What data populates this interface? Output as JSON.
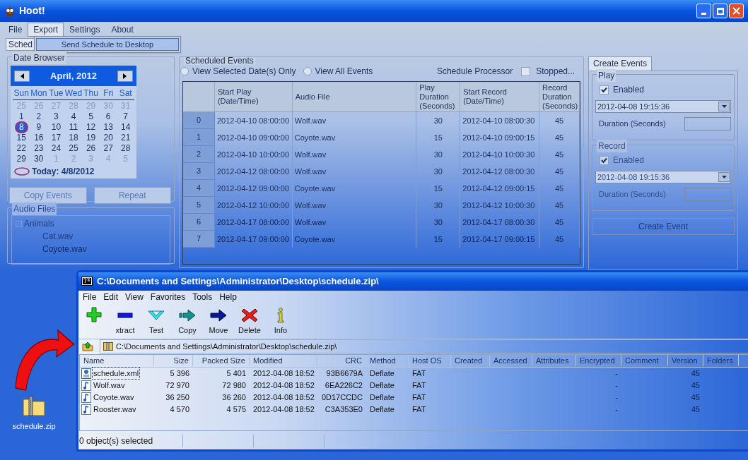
{
  "hoot_window": {
    "title": "Hoot!",
    "menu": [
      {
        "label": "File",
        "selected": false
      },
      {
        "label": "Export",
        "selected": true
      },
      {
        "label": "Settings",
        "selected": false
      },
      {
        "label": "About",
        "selected": false
      }
    ],
    "export_menu": [
      "Send Schedule to Desktop"
    ],
    "tab": "Sched",
    "date_browser": {
      "title": "Date Browser",
      "month": "April, 2012",
      "weekdays": [
        "Sun",
        "Mon",
        "Tue",
        "Wed",
        "Thu",
        "Fri",
        "Sat"
      ],
      "days": [
        {
          "label": "25",
          "muted": true,
          "selected": false
        },
        {
          "label": "26",
          "muted": true,
          "selected": false
        },
        {
          "label": "27",
          "muted": true,
          "selected": false
        },
        {
          "label": "28",
          "muted": true,
          "selected": false
        },
        {
          "label": "29",
          "muted": true,
          "selected": false
        },
        {
          "label": "30",
          "muted": true,
          "selected": false
        },
        {
          "label": "31",
          "muted": true,
          "selected": false
        },
        {
          "label": "1",
          "muted": false,
          "selected": false
        },
        {
          "label": "2",
          "muted": false,
          "selected": false
        },
        {
          "label": "3",
          "muted": false,
          "selected": false
        },
        {
          "label": "4",
          "muted": false,
          "selected": false
        },
        {
          "label": "5",
          "muted": false,
          "selected": false
        },
        {
          "label": "6",
          "muted": false,
          "selected": false
        },
        {
          "label": "7",
          "muted": false,
          "selected": false
        },
        {
          "label": "8",
          "muted": false,
          "selected": true
        },
        {
          "label": "9",
          "muted": false,
          "selected": false
        },
        {
          "label": "10",
          "muted": false,
          "selected": false
        },
        {
          "label": "11",
          "muted": false,
          "selected": false
        },
        {
          "label": "12",
          "muted": false,
          "selected": false
        },
        {
          "label": "13",
          "muted": false,
          "selected": false
        },
        {
          "label": "14",
          "muted": false,
          "selected": false
        },
        {
          "label": "15",
          "muted": false,
          "selected": false
        },
        {
          "label": "16",
          "muted": false,
          "selected": false
        },
        {
          "label": "17",
          "muted": false,
          "selected": false
        },
        {
          "label": "18",
          "muted": false,
          "selected": false
        },
        {
          "label": "19",
          "muted": false,
          "selected": false
        },
        {
          "label": "20",
          "muted": false,
          "selected": false
        },
        {
          "label": "21",
          "muted": false,
          "selected": false
        },
        {
          "label": "22",
          "muted": false,
          "selected": false
        },
        {
          "label": "23",
          "muted": false,
          "selected": false
        },
        {
          "label": "24",
          "muted": false,
          "selected": false
        },
        {
          "label": "25",
          "muted": false,
          "selected": false
        },
        {
          "label": "26",
          "muted": false,
          "selected": false
        },
        {
          "label": "27",
          "muted": false,
          "selected": false
        },
        {
          "label": "28",
          "muted": false,
          "selected": false
        },
        {
          "label": "29",
          "muted": false,
          "selected": false
        },
        {
          "label": "30",
          "muted": false,
          "selected": false
        },
        {
          "label": "1",
          "muted": true,
          "selected": false
        },
        {
          "label": "2",
          "muted": true,
          "selected": false
        },
        {
          "label": "3",
          "muted": true,
          "selected": false
        },
        {
          "label": "4",
          "muted": true,
          "selected": false
        },
        {
          "label": "5",
          "muted": true,
          "selected": false
        }
      ],
      "today": "Today: 4/8/2012"
    },
    "buttons": [
      "Copy Events",
      "Repeat"
    ],
    "audio_files": {
      "title": "Audio Files",
      "tree": [
        {
          "label": "Animals",
          "expanded": true,
          "children": [
            {
              "label": "Cat.wav"
            },
            {
              "label": "Coyote.wav"
            }
          ]
        }
      ]
    },
    "scheduled_events": {
      "title": "Scheduled Events",
      "radios": [
        {
          "label": "View Selected Date(s) Only",
          "selected": false
        },
        {
          "label": "View All Events",
          "selected": false
        }
      ],
      "processor_label": "Schedule Processor",
      "processor": {
        "label": "Stopped...",
        "checked": false
      },
      "columns": [
        "Start Play (Date/Time)",
        "Audio File",
        "Play Duration (Seconds)",
        "Start Record (Date/Time)",
        "Record Duration (Seconds)"
      ],
      "rows": [
        {
          "index": "0",
          "cells": [
            "2012-04-10 08:00:00",
            "Wolf.wav",
            "30",
            "2012-04-10 08:00:30",
            "45"
          ]
        },
        {
          "index": "1",
          "cells": [
            "2012-04-10 09:00:00",
            "Coyote.wav",
            "15",
            "2012-04-10 09:00:15",
            "45"
          ]
        },
        {
          "index": "2",
          "cells": [
            "2012-04-10 10:00:00",
            "Wolf.wav",
            "30",
            "2012-04-10 10:00:30",
            "45"
          ]
        },
        {
          "index": "3",
          "cells": [
            "2012-04-12 08:00:00",
            "Wolf.wav",
            "30",
            "2012-04-12 08:00:30",
            "45"
          ]
        },
        {
          "index": "4",
          "cells": [
            "2012-04-12 09:00:00",
            "Coyote.wav",
            "15",
            "2012-04-12 09:00:15",
            "45"
          ]
        },
        {
          "index": "5",
          "cells": [
            "2012-04-12 10:00:00",
            "Wolf.wav",
            "30",
            "2012-04-12 10:00:30",
            "45"
          ]
        },
        {
          "index": "6",
          "cells": [
            "2012-04-17 08:00:00",
            "Wolf.wav",
            "30",
            "2012-04-17 08:00:30",
            "45"
          ]
        },
        {
          "index": "7",
          "cells": [
            "2012-04-17 09:00:00",
            "Coyote.wav",
            "15",
            "2012-04-17 09:00:15",
            "45"
          ]
        }
      ]
    },
    "create_events": {
      "tab": "Create Events",
      "groups": [
        {
          "title": "Play",
          "enabled": {
            "label": "Enabled",
            "checked": true
          },
          "datetime": "2012-04-08 19:15:36",
          "duration_label": "Duration (Seconds)"
        },
        {
          "title": "Record",
          "enabled": {
            "label": "Enabled",
            "checked": true
          },
          "datetime": "2012-04-08 19:15:36",
          "duration_label": "Duration (Seconds)"
        }
      ],
      "button": "Create Event"
    }
  },
  "archive_window": {
    "title": "C:\\Documents and Settings\\Administrator\\Desktop\\schedule.zip\\",
    "menu": [
      "File",
      "Edit",
      "View",
      "Favorites",
      "Tools",
      "Help"
    ],
    "toolbar": [
      {
        "kind": "add"
      },
      {
        "kind": "extract",
        "label": "xtract"
      },
      {
        "kind": "test",
        "label": "Test"
      },
      {
        "kind": "copy",
        "label": "Copy"
      },
      {
        "kind": "move",
        "label": "Move"
      },
      {
        "kind": "delete",
        "label": "Delete"
      },
      {
        "kind": "info",
        "label": "Info"
      }
    ],
    "address": "C:\\Documents and Settings\\Administrator\\Desktop\\schedule.zip\\",
    "columns": [
      "Name",
      "Size",
      "Packed Size",
      "Modified",
      "CRC",
      "Method",
      "Host OS",
      "Created",
      "Accessed",
      "Attributes",
      "Encrypted",
      "Comment",
      "Version",
      "Folders"
    ],
    "rows": [
      {
        "kind": "xml",
        "selected": true,
        "cells": [
          "schedule.xml",
          "5 396",
          "5 401",
          "2012-04-08 18:52",
          "93B6679A",
          "Deflate",
          "FAT",
          "",
          "",
          "",
          "-",
          "",
          "45",
          ""
        ]
      },
      {
        "kind": "audio",
        "selected": false,
        "cells": [
          "Wolf.wav",
          "72 970",
          "72 980",
          "2012-04-08 18:52",
          "6EA226C2",
          "Deflate",
          "FAT",
          "",
          "",
          "",
          "-",
          "",
          "45",
          ""
        ]
      },
      {
        "kind": "audio",
        "selected": false,
        "cells": [
          "Coyote.wav",
          "36 250",
          "36 260",
          "2012-04-08 18:52",
          "0D17CCDC",
          "Deflate",
          "FAT",
          "",
          "",
          "",
          "-",
          "",
          "45",
          ""
        ]
      },
      {
        "kind": "audio",
        "selected": false,
        "cells": [
          "Rooster.wav",
          "4 570",
          "4 575",
          "2012-04-08 18:52",
          "C3A353E0",
          "Deflate",
          "FAT",
          "",
          "",
          "",
          "-",
          "",
          "45",
          ""
        ]
      }
    ],
    "status": "0 object(s) selected"
  },
  "desktop_icon": {
    "label": "schedule.zip"
  }
}
